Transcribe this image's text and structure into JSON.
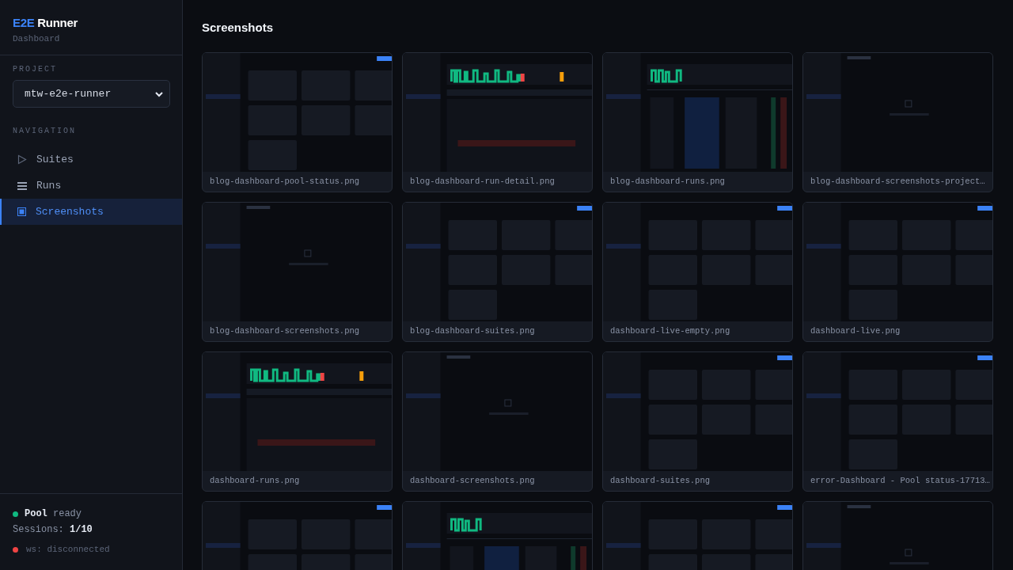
{
  "sidebar": {
    "logo": {
      "accent": "E2E",
      "name": "Runner"
    },
    "subtitle": "Dashboard",
    "project": {
      "label": "PROJECT",
      "value": "mtw-e2e-runner"
    },
    "navigation": {
      "label": "NAVIGATION",
      "items": [
        {
          "label": "Suites",
          "kind": "suites",
          "selected": false
        },
        {
          "label": "Runs",
          "kind": "runs",
          "selected": false
        },
        {
          "label": "Screenshots",
          "kind": "screenshots",
          "selected": true
        }
      ]
    },
    "pool": {
      "label": "Pool",
      "state": "ready",
      "healthy": true,
      "sessions_label": "Sessions:",
      "sessions": "1/10"
    },
    "connection": {
      "text": "ws: disconnected",
      "connected": false
    }
  },
  "main": {
    "title": "Screenshots",
    "screenshots": [
      {
        "kind": "picture",
        "file": "blog-dashboard-pool-status.png"
      },
      {
        "kind": "picture",
        "file": "blog-dashboard-run-detail.png"
      },
      {
        "kind": "picture",
        "file": "blog-dashboard-runs.png"
      },
      {
        "kind": "picture",
        "file": "blog-dashboard-screenshots-project…"
      },
      {
        "kind": "picture",
        "file": "blog-dashboard-screenshots.png"
      },
      {
        "kind": "picture",
        "file": "blog-dashboard-suites.png"
      },
      {
        "kind": "picture",
        "file": "dashboard-live-empty.png"
      },
      {
        "kind": "picture",
        "file": "dashboard-live.png"
      },
      {
        "kind": "picture",
        "file": "dashboard-runs.png"
      },
      {
        "kind": "picture",
        "file": "dashboard-screenshots.png"
      },
      {
        "kind": "picture",
        "file": "dashboard-suites.png"
      },
      {
        "kind": "picture",
        "file": "error-Dashboard - Pool status-17713…"
      },
      {
        "kind": "picture"
      },
      {
        "kind": "picture"
      },
      {
        "kind": "picture"
      },
      {
        "kind": "picture"
      }
    ]
  }
}
